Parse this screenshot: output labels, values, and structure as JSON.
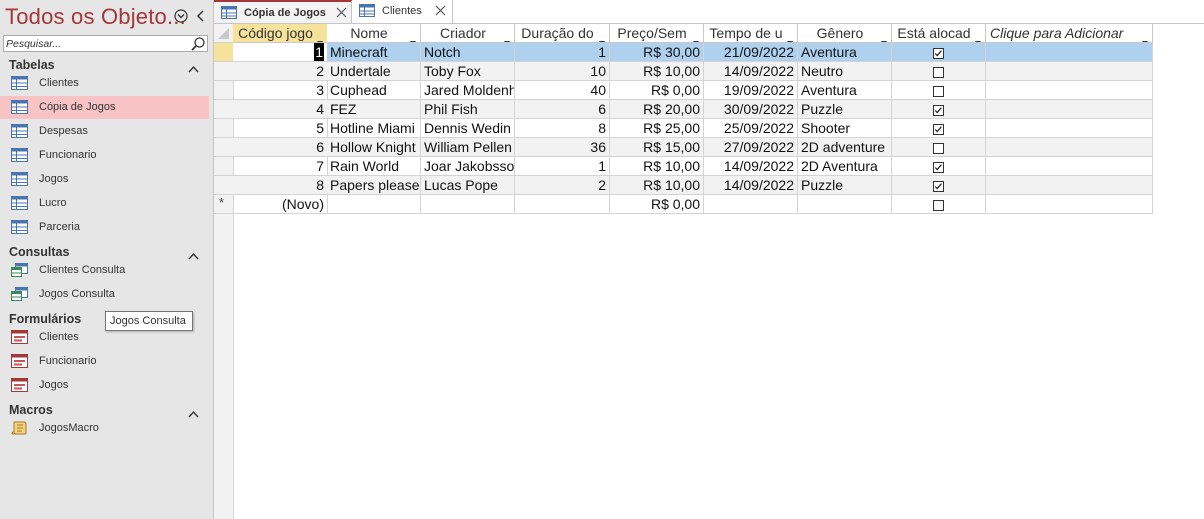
{
  "nav": {
    "title": "Todos os Objeto...",
    "search_placeholder": "Pesquisar...",
    "groups": [
      {
        "label": "Tabelas",
        "items": [
          "Clientes",
          "Cópia de Jogos",
          "Despesas",
          "Funcionario",
          "Jogos",
          "Lucro",
          "Parceria"
        ],
        "selected": "Cópia de Jogos"
      },
      {
        "label": "Consultas",
        "items": [
          "Clientes Consulta",
          "Jogos Consulta"
        ]
      },
      {
        "label": "Formulários",
        "items": [
          "Clientes",
          "Funcionario",
          "Jogos"
        ]
      },
      {
        "label": "Macros",
        "items": [
          "JogosMacro"
        ]
      }
    ],
    "tooltip": "Jogos Consulta"
  },
  "tabs": [
    {
      "label": "Cópia de Jogos",
      "active": true
    },
    {
      "label": "Clientes",
      "active": false
    }
  ],
  "table": {
    "columns": [
      "Código jogo",
      "Nome",
      "Criador",
      "Duração do",
      "Preço/Sem",
      "Tempo de u",
      "Gênero",
      "Está alocad",
      "Clique para Adicionar"
    ],
    "rows": [
      [
        "1",
        "Minecraft",
        "Notch",
        "1",
        "R$ 30,00",
        "21/09/2022",
        "Aventura",
        true
      ],
      [
        "2",
        "Undertale",
        "Toby Fox",
        "10",
        "R$ 10,00",
        "14/09/2022",
        "Neutro",
        false
      ],
      [
        "3",
        "Cuphead",
        "Jared Moldenhauer",
        "40",
        "R$ 0,00",
        "19/09/2022",
        "Aventura",
        false
      ],
      [
        "4",
        "FEZ",
        "Phil Fish",
        "6",
        "R$ 20,00",
        "30/09/2022",
        "Puzzle",
        true
      ],
      [
        "5",
        "Hotline Miami",
        " Dennis Wedin",
        "8",
        "R$ 25,00",
        "25/09/2022",
        "Shooter",
        true
      ],
      [
        "6",
        "Hollow Knight",
        "William Pellen",
        "36",
        "R$ 15,00",
        "27/09/2022",
        "2D adventure",
        false
      ],
      [
        "7",
        "Rain World",
        "Joar Jakobsson",
        "1",
        "R$ 10,00",
        "14/09/2022",
        "2D Aventura",
        true
      ],
      [
        "8",
        "Papers please",
        "Lucas Pope",
        "2",
        "R$ 10,00",
        "14/09/2022",
        "Puzzle",
        true
      ]
    ],
    "new_row": {
      "label": "(Novo)",
      "price": "R$ 0,00",
      "new_marker": "*"
    }
  },
  "colors": {
    "accent": "#a4373a",
    "selected_nav": "#f7c3c5",
    "selected_row": "#aed1f0",
    "sorted_header": "#f7e29c"
  }
}
